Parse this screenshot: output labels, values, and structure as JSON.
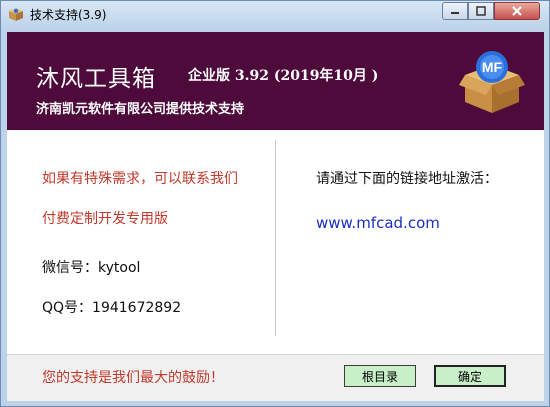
{
  "window": {
    "title": "技术支持(3.9)"
  },
  "banner": {
    "title": "沐风工具箱",
    "edition": "企业版 3.92 (2019年10月 )",
    "company": "济南凯元软件有限公司提供技术支持"
  },
  "left": {
    "line1": "如果有特殊需求，可以联系我们",
    "line2": "付费定制开发专用版",
    "wechat": "微信号：kytool",
    "qq": "QQ号：1941672892"
  },
  "right": {
    "prompt": "请通过下面的链接地址激活：",
    "link": "www.mfcad.com"
  },
  "footer": {
    "message": "您的支持是我们最大的鼓励！",
    "root_button": "根目录",
    "ok_button": "确定"
  },
  "colors": {
    "banner": "#4e0a3b",
    "accent_red": "#c0392b",
    "link_blue": "#1a2fbf",
    "button_green": "#c8f0c8"
  },
  "icons": [
    "app-box-icon",
    "minimize-icon",
    "maximize-icon",
    "close-icon",
    "product-box-logo-icon"
  ]
}
